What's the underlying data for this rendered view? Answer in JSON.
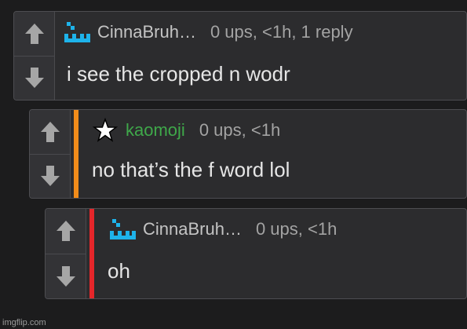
{
  "comments": [
    {
      "username": "CinnaBruh…",
      "user_color": "#c4c4c4",
      "avatar_icon": "pixel-avatar-icon",
      "meta": "0 ups, <1h, 1 reply",
      "text": "i see the cropped n wodr"
    },
    {
      "username": "kaomoji",
      "user_color": "#3fa84a",
      "avatar_icon": "star-icon",
      "meta": "0 ups, <1h",
      "text": "no that’s the f word lol",
      "bar_color": "#f28c1a"
    },
    {
      "username": "CinnaBruh…",
      "user_color": "#c4c4c4",
      "avatar_icon": "pixel-avatar-icon",
      "meta": "0 ups, <1h",
      "text": "oh",
      "bar_color": "#e5262a"
    }
  ],
  "watermark": "imgflip.com",
  "colors": {
    "background": "#1c1c1d",
    "panel": "#2c2c2e",
    "avatar_blue": "#1eb3ea",
    "arrow": "#a6a6a6"
  }
}
